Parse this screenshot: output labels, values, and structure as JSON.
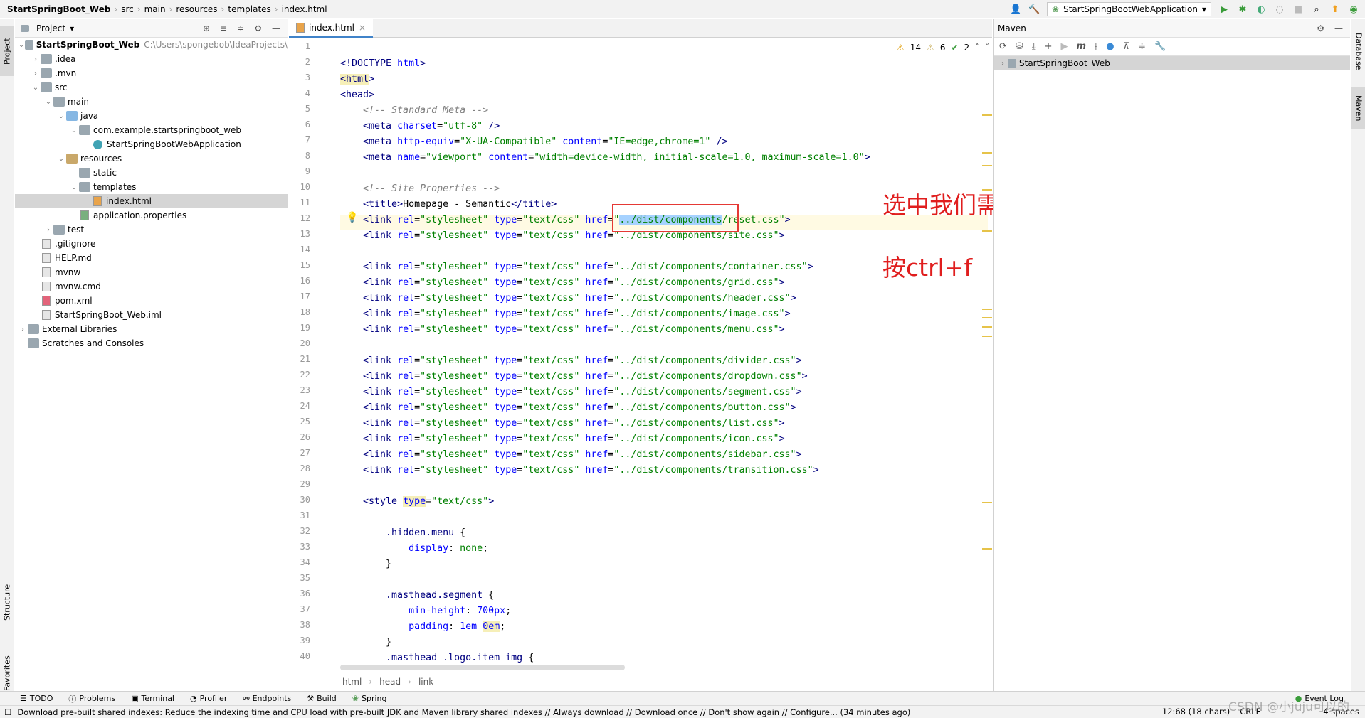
{
  "navbar": {
    "crumbs": [
      "StartSpringBoot_Web",
      "src",
      "main",
      "resources",
      "templates",
      "index.html"
    ],
    "run_config": "StartSpringBootWebApplication"
  },
  "left_stripe": {
    "project": "Project",
    "structure": "Structure",
    "favorites": "Favorites"
  },
  "project": {
    "header": "Project",
    "tree": [
      {
        "indent": 0,
        "arrow": "v",
        "icon": "folder",
        "label": "StartSpringBoot_Web",
        "path": "C:\\Users\\spongebob\\IdeaProjects\\",
        "bold": true
      },
      {
        "indent": 1,
        "arrow": ">",
        "icon": "folder",
        "label": ".idea"
      },
      {
        "indent": 1,
        "arrow": ">",
        "icon": "folder",
        "label": ".mvn"
      },
      {
        "indent": 1,
        "arrow": "v",
        "icon": "folder",
        "label": "src"
      },
      {
        "indent": 2,
        "arrow": "v",
        "icon": "folder",
        "label": "main"
      },
      {
        "indent": 3,
        "arrow": "v",
        "icon": "folder-blue",
        "label": "java"
      },
      {
        "indent": 4,
        "arrow": "v",
        "icon": "folder",
        "label": "com.example.startspringboot_web"
      },
      {
        "indent": 5,
        "arrow": "",
        "icon": "class",
        "label": "StartSpringBootWebApplication"
      },
      {
        "indent": 3,
        "arrow": "v",
        "icon": "folder-res",
        "label": "resources"
      },
      {
        "indent": 4,
        "arrow": "",
        "icon": "folder",
        "label": "static"
      },
      {
        "indent": 4,
        "arrow": "v",
        "icon": "folder",
        "label": "templates"
      },
      {
        "indent": 5,
        "arrow": "",
        "icon": "html",
        "label": "index.html",
        "selected": true
      },
      {
        "indent": 4,
        "arrow": "",
        "icon": "props",
        "label": "application.properties"
      },
      {
        "indent": 2,
        "arrow": ">",
        "icon": "folder",
        "label": "test"
      },
      {
        "indent": 1,
        "arrow": "",
        "icon": "file",
        "label": ".gitignore"
      },
      {
        "indent": 1,
        "arrow": "",
        "icon": "file",
        "label": "HELP.md"
      },
      {
        "indent": 1,
        "arrow": "",
        "icon": "file",
        "label": "mvnw"
      },
      {
        "indent": 1,
        "arrow": "",
        "icon": "file",
        "label": "mvnw.cmd"
      },
      {
        "indent": 1,
        "arrow": "",
        "icon": "xml",
        "label": "pom.xml"
      },
      {
        "indent": 1,
        "arrow": "",
        "icon": "file",
        "label": "StartSpringBoot_Web.iml"
      },
      {
        "indent": 0,
        "arrow": ">",
        "icon": "folder",
        "label": "External Libraries"
      },
      {
        "indent": 0,
        "arrow": "",
        "icon": "folder",
        "label": "Scratches and Consoles"
      }
    ]
  },
  "editor": {
    "tab": "index.html",
    "inspections": {
      "warnings": "14",
      "weak": "6",
      "ok": "2"
    },
    "lines": [
      "1",
      "2",
      "3",
      "4",
      "5",
      "6",
      "7",
      "8",
      "9",
      "10",
      "11",
      "12",
      "13",
      "14",
      "15",
      "16",
      "17",
      "18",
      "19",
      "20",
      "21",
      "22",
      "23",
      "24",
      "25",
      "26",
      "27",
      "28",
      "29",
      "30",
      "31",
      "32",
      "33",
      "34",
      "35",
      "36",
      "37",
      "38",
      "39",
      "40"
    ],
    "breadcrumbs": [
      "html",
      "head",
      "link"
    ]
  },
  "annotations": {
    "line1": "选中我们需要替换的信息进行批量替换",
    "line2": "按ctrl+f"
  },
  "maven": {
    "title": "Maven",
    "project": "StartSpringBoot_Web",
    "stripe_database": "Database",
    "stripe_maven": "Maven"
  },
  "toolstrip": [
    "TODO",
    "Problems",
    "Terminal",
    "Profiler",
    "Endpoints",
    "Build",
    "Spring"
  ],
  "event_log": "Event Log",
  "status": {
    "message": "Download pre-built shared indexes: Reduce the indexing time and CPU load with pre-built JDK and Maven library shared indexes // Always download // Download once // Don't show again // Configure... (34 minutes ago)",
    "position": "12:68 (18 chars)",
    "line_sep": "CRLF",
    "indent": "4 spaces"
  },
  "watermark": "CSDN @小juju可以的"
}
